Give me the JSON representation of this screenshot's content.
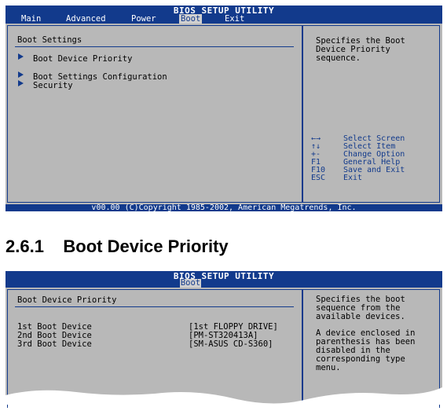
{
  "screen1": {
    "utility_title": "BIOS SETUP UTILITY",
    "menu": [
      {
        "label": "Main",
        "active": false
      },
      {
        "label": "Advanced",
        "active": false
      },
      {
        "label": "Power",
        "active": false
      },
      {
        "label": "Boot",
        "active": true
      },
      {
        "label": "Exit",
        "active": false
      }
    ],
    "panel_title": "Boot Settings",
    "items": [
      "Boot Device Priority",
      "Boot Settings Configuration",
      "Security"
    ],
    "help_lines": [
      "Specifies the Boot",
      "Device Priority",
      "sequence."
    ],
    "keys": [
      {
        "key": "←→",
        "desc": "Select Screen"
      },
      {
        "key": "↑↓",
        "desc": "Select Item"
      },
      {
        "key": "+-",
        "desc": "Change Option"
      },
      {
        "key": "F1",
        "desc": "General Help"
      },
      {
        "key": "F10",
        "desc": "Save and Exit"
      },
      {
        "key": "ESC",
        "desc": "Exit"
      }
    ],
    "footer": "v00.00 (C)Copyright 1985-2002, American Megatrends, Inc."
  },
  "section_heading": "2.6.1    Boot Device Priority",
  "screen2": {
    "utility_title": "BIOS SETUP UTILITY",
    "active_tab": "Boot",
    "panel_title": "Boot Device Priority",
    "devices": [
      {
        "label": "1st Boot Device",
        "value": "[1st FLOPPY DRIVE]"
      },
      {
        "label": "2nd Boot Device",
        "value": "[PM-ST320413A]"
      },
      {
        "label": "3rd Boot Device",
        "value": "[SM-ASUS CD-S360]"
      }
    ],
    "help_lines": [
      "Specifies the boot",
      "sequence from the",
      "available devices.",
      "",
      "A device enclosed in",
      "parenthesis has been",
      "disabled in the",
      "corresponding type",
      "menu."
    ]
  },
  "colors": {
    "bios_blue": "#123a8c",
    "panel_gray": "#b8b8b8"
  }
}
